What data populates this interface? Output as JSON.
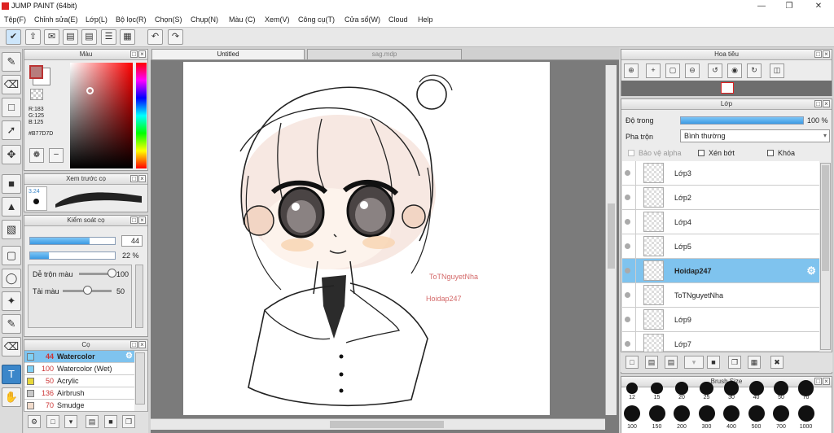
{
  "app": {
    "title": "JUMP PAINT (64bit)"
  },
  "menu": [
    "Tệp(F)",
    "Chỉnh sửa(E)",
    "Lớp(L)",
    "Bộ lọc(R)",
    "Chọn(S)",
    "Chụp(N)",
    "Màu (C)",
    "Xem(V)",
    "Công cụ(T)",
    "Cửa sổ(W)",
    "Cloud",
    "Help"
  ],
  "color_panel": {
    "title": "Màu",
    "r": "R:183",
    "g": "G:125",
    "b": "B:125",
    "hex": "#B77D7D",
    "fg_color": "#b77d7d"
  },
  "brush_preview": {
    "title": "Xem trước cọ",
    "size_label": "3.24"
  },
  "brush_control": {
    "title": "Kiểm soát cọ",
    "size_value": "44",
    "size_fraction": 0.7,
    "opacity_value": "22 %",
    "opacity_fraction": 0.22,
    "mix_label": "Dễ trộn màu",
    "mix_value": "100",
    "mix_fraction": 1.0,
    "refill_label": "Tải màu",
    "refill_value": "50",
    "refill_fraction": 0.5
  },
  "brushes": {
    "title": "Cọ",
    "items": [
      {
        "size": "44",
        "name": "Watercolor",
        "swatch": "#7fd0f5",
        "selected": true
      },
      {
        "size": "100",
        "name": "Watercolor (Wet)",
        "swatch": "#7fd0f5",
        "selected": false
      },
      {
        "size": "50",
        "name": "Acrylic",
        "swatch": "#e8d83a",
        "selected": false
      },
      {
        "size": "136",
        "name": "Airbrush",
        "swatch": "#c8c8c8",
        "selected": false
      },
      {
        "size": "70",
        "name": "Smudge",
        "swatch": "#f2dccc",
        "selected": false
      }
    ]
  },
  "tabs": {
    "active": "Untitled",
    "other": "sag.mdp"
  },
  "canvas_text": {
    "line1": "ToTNguyetNha",
    "line2": "Hoidap247"
  },
  "navigator": {
    "title": "Hoa tiêu"
  },
  "layers": {
    "title": "Lớp",
    "opacity_label": "Độ trong",
    "opacity_value": "100 %",
    "opacity_fraction": 1.0,
    "blend_label": "Pha trộn",
    "blend_value": "Bình thường",
    "protect_alpha": "Bảo vệ alpha",
    "clip": "Xén bớt",
    "lock": "Khóa",
    "items": [
      {
        "name": "Lớp3",
        "selected": false
      },
      {
        "name": "Lớp2",
        "selected": false
      },
      {
        "name": "Lớp4",
        "selected": false
      },
      {
        "name": "Lớp5",
        "selected": false
      },
      {
        "name": "Hoidap247",
        "selected": true
      },
      {
        "name": "ToTNguyetNha",
        "selected": false
      },
      {
        "name": "Lớp9",
        "selected": false
      },
      {
        "name": "Lớp7",
        "selected": false
      }
    ]
  },
  "brush_size": {
    "title": "Brush Size",
    "row1": [
      "12",
      "15",
      "20",
      "25",
      "30",
      "40",
      "50",
      "70"
    ],
    "row2": [
      "100",
      "150",
      "200",
      "300",
      "400",
      "500",
      "700",
      "1000"
    ]
  }
}
